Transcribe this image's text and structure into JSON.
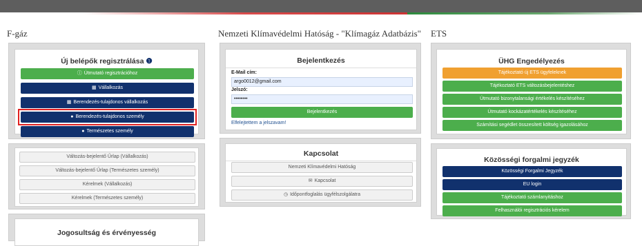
{
  "columns": {
    "fgaz": "F-gáz",
    "nkh": "Nemzeti Klímavédelmi Hatóság - \"Klímagáz Adatbázis\"",
    "ets": "ETS"
  },
  "new_users": {
    "title": "Új belépők regisztrálása",
    "buttons": [
      "Útmutató regisztrációhoz",
      "Vállalkozás",
      "Berendezés-tulajdonos vállalkozás",
      "Berendezés-tulajdonos személy",
      "Természetes személy"
    ]
  },
  "forms": {
    "buttons": [
      "Változás-bejelentő Űrlap (Vállalkozás)",
      "Változás-bejelentő Űrlap (Természetes személy)",
      "Kérelmek (Vállalkozás)",
      "Kérelmek (Természetes személy)"
    ]
  },
  "rights": {
    "title": "Jogosultság és érvényesség"
  },
  "login": {
    "title": "Bejelentkezés",
    "email_label": "E-Mail cím:",
    "email_value": "argo0012@gmail.com",
    "password_label": "Jelszó:",
    "password_value": "••••••••",
    "submit": "Bejelentkezés",
    "forgot": "Elfelejtettem a jelszavam!"
  },
  "contact": {
    "title": "Kapcsolat",
    "buttons": [
      "Nemzeti Klímavédelmi Hatóság",
      "Kapcsolat",
      "Időpontfoglalás ügyfélszolgálatra"
    ]
  },
  "uhg": {
    "title": "ÜHG Engedélyezés",
    "buttons": [
      "Tájékoztató új ETS ügyfeleknek",
      "Tájékoztató ETS változásbejelentéshez",
      "Útmutató bizonytalansági értékelés készítéséhez",
      "Útmutató kockázatértékelés készítéséhez",
      "Számítási segédlet összesített költség igazolásához"
    ]
  },
  "registry": {
    "title": "Közösségi forgalmi jegyzék",
    "buttons": [
      "Közösségi Forgalmi Jegyzék",
      "EU login",
      "Tájékoztató számlanyitáshoz",
      "Felhasználói regisztrációs kérelem"
    ]
  },
  "colors": {
    "green": "#4cae4c",
    "navy": "#11316d",
    "orange": "#f0a030",
    "highlight": "#e02020"
  }
}
